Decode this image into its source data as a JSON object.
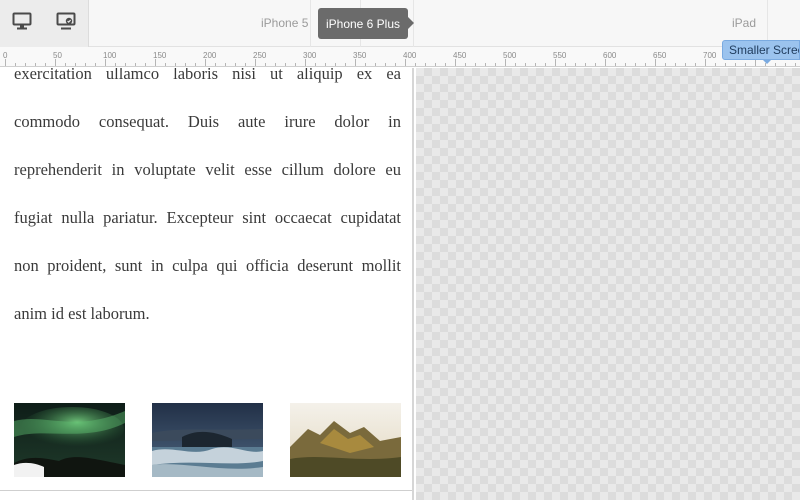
{
  "toolbar": {
    "icons": [
      "monitor-icon",
      "screen-sync-icon"
    ],
    "breakpoints": {
      "iphone5": "iPhone 5",
      "iphone6plus": "iPhone 6 Plus",
      "ipad": "iPad"
    }
  },
  "ruler": {
    "marks": [
      0,
      50,
      100,
      150,
      200,
      250,
      300,
      350,
      400,
      450,
      500,
      550,
      600,
      650,
      700
    ]
  },
  "smaller_screens_tab": "Smaller Scree",
  "preview": {
    "body_text": "exercitation ullamco laboris nisi ut aliquip ex ea commodo consequat. Duis aute irure dolor in reprehenderit in voluptate velit esse cillum dolore eu fugiat nulla pariatur. Excepteur sint occaecat cupidatat non proident, sunt in culpa qui officia deserunt mollit anim id est laborum.",
    "thumbnails": [
      "aurora-photo",
      "ocean-wave-photo",
      "mountain-photo"
    ]
  },
  "colors": {
    "active_breakpoint": "#6b6b6b",
    "smaller_screens_tab": "#9bc3ee"
  }
}
